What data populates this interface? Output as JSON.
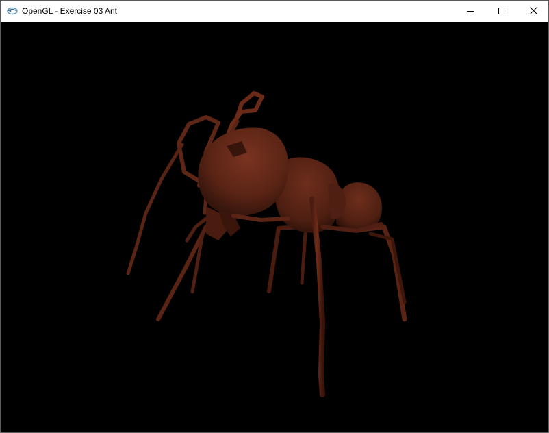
{
  "window": {
    "title": "OpenGL - Exercise 03 Ant",
    "icon": "opengl-app-icon",
    "controls": [
      "minimize-icon",
      "maximize-icon",
      "close-icon"
    ]
  },
  "viewport": {
    "background": "#000000",
    "model": "ant",
    "model_color": "#6b2a18"
  }
}
